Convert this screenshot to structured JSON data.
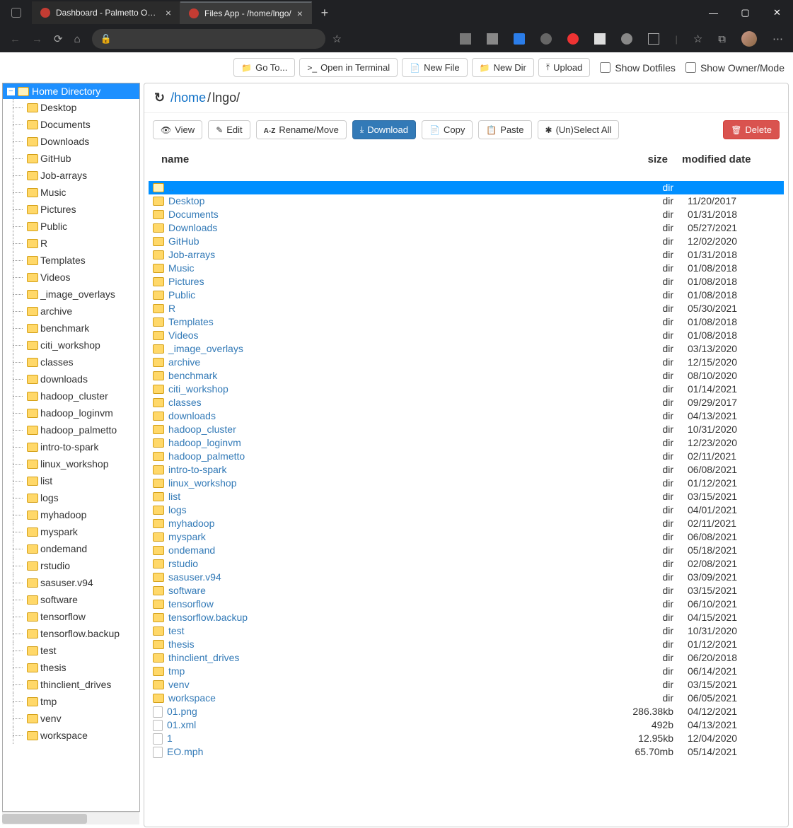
{
  "browser": {
    "tabs": [
      {
        "title": "Dashboard - Palmetto OnDeman",
        "active": false
      },
      {
        "title": "Files App - /home/lngo/",
        "active": true
      }
    ]
  },
  "app_toolbar": {
    "goto": "Go To...",
    "terminal": "Open in Terminal",
    "newfile": "New File",
    "newdir": "New Dir",
    "upload": "Upload",
    "dotfiles": "Show Dotfiles",
    "owner": "Show Owner/Mode"
  },
  "sidebar": {
    "root": "Home Directory",
    "items": [
      "Desktop",
      "Documents",
      "Downloads",
      "GitHub",
      "Job-arrays",
      "Music",
      "Pictures",
      "Public",
      "R",
      "Templates",
      "Videos",
      "_image_overlays",
      "archive",
      "benchmark",
      "citi_workshop",
      "classes",
      "downloads",
      "hadoop_cluster",
      "hadoop_loginvm",
      "hadoop_palmetto",
      "intro-to-spark",
      "linux_workshop",
      "list",
      "logs",
      "myhadoop",
      "myspark",
      "ondemand",
      "rstudio",
      "sasuser.v94",
      "software",
      "tensorflow",
      "tensorflow.backup",
      "test",
      "thesis",
      "thinclient_drives",
      "tmp",
      "venv",
      "workspace"
    ]
  },
  "breadcrumb": {
    "home": "/home",
    "sep": "/",
    "cur": "lngo/"
  },
  "file_toolbar": {
    "view": "View",
    "edit": "Edit",
    "rename": "Rename/Move",
    "download": "Download",
    "copy": "Copy",
    "paste": "Paste",
    "select": "(Un)Select All",
    "delete": "Delete"
  },
  "columns": {
    "name": "name",
    "size": "size",
    "date": "modified date"
  },
  "files": [
    {
      "n": "..",
      "s": "dir",
      "d": "",
      "dir": true,
      "sel": true
    },
    {
      "n": "Desktop",
      "s": "dir",
      "d": "11/20/2017",
      "dir": true
    },
    {
      "n": "Documents",
      "s": "dir",
      "d": "01/31/2018",
      "dir": true
    },
    {
      "n": "Downloads",
      "s": "dir",
      "d": "05/27/2021",
      "dir": true
    },
    {
      "n": "GitHub",
      "s": "dir",
      "d": "12/02/2020",
      "dir": true
    },
    {
      "n": "Job-arrays",
      "s": "dir",
      "d": "01/31/2018",
      "dir": true
    },
    {
      "n": "Music",
      "s": "dir",
      "d": "01/08/2018",
      "dir": true
    },
    {
      "n": "Pictures",
      "s": "dir",
      "d": "01/08/2018",
      "dir": true
    },
    {
      "n": "Public",
      "s": "dir",
      "d": "01/08/2018",
      "dir": true
    },
    {
      "n": "R",
      "s": "dir",
      "d": "05/30/2021",
      "dir": true
    },
    {
      "n": "Templates",
      "s": "dir",
      "d": "01/08/2018",
      "dir": true
    },
    {
      "n": "Videos",
      "s": "dir",
      "d": "01/08/2018",
      "dir": true
    },
    {
      "n": "_image_overlays",
      "s": "dir",
      "d": "03/13/2020",
      "dir": true
    },
    {
      "n": "archive",
      "s": "dir",
      "d": "12/15/2020",
      "dir": true
    },
    {
      "n": "benchmark",
      "s": "dir",
      "d": "08/10/2020",
      "dir": true
    },
    {
      "n": "citi_workshop",
      "s": "dir",
      "d": "01/14/2021",
      "dir": true
    },
    {
      "n": "classes",
      "s": "dir",
      "d": "09/29/2017",
      "dir": true
    },
    {
      "n": "downloads",
      "s": "dir",
      "d": "04/13/2021",
      "dir": true
    },
    {
      "n": "hadoop_cluster",
      "s": "dir",
      "d": "10/31/2020",
      "dir": true
    },
    {
      "n": "hadoop_loginvm",
      "s": "dir",
      "d": "12/23/2020",
      "dir": true
    },
    {
      "n": "hadoop_palmetto",
      "s": "dir",
      "d": "02/11/2021",
      "dir": true
    },
    {
      "n": "intro-to-spark",
      "s": "dir",
      "d": "06/08/2021",
      "dir": true
    },
    {
      "n": "linux_workshop",
      "s": "dir",
      "d": "01/12/2021",
      "dir": true
    },
    {
      "n": "list",
      "s": "dir",
      "d": "03/15/2021",
      "dir": true
    },
    {
      "n": "logs",
      "s": "dir",
      "d": "04/01/2021",
      "dir": true
    },
    {
      "n": "myhadoop",
      "s": "dir",
      "d": "02/11/2021",
      "dir": true
    },
    {
      "n": "myspark",
      "s": "dir",
      "d": "06/08/2021",
      "dir": true
    },
    {
      "n": "ondemand",
      "s": "dir",
      "d": "05/18/2021",
      "dir": true
    },
    {
      "n": "rstudio",
      "s": "dir",
      "d": "02/08/2021",
      "dir": true
    },
    {
      "n": "sasuser.v94",
      "s": "dir",
      "d": "03/09/2021",
      "dir": true
    },
    {
      "n": "software",
      "s": "dir",
      "d": "03/15/2021",
      "dir": true
    },
    {
      "n": "tensorflow",
      "s": "dir",
      "d": "06/10/2021",
      "dir": true
    },
    {
      "n": "tensorflow.backup",
      "s": "dir",
      "d": "04/15/2021",
      "dir": true
    },
    {
      "n": "test",
      "s": "dir",
      "d": "10/31/2020",
      "dir": true
    },
    {
      "n": "thesis",
      "s": "dir",
      "d": "01/12/2021",
      "dir": true
    },
    {
      "n": "thinclient_drives",
      "s": "dir",
      "d": "06/20/2018",
      "dir": true
    },
    {
      "n": "tmp",
      "s": "dir",
      "d": "06/14/2021",
      "dir": true
    },
    {
      "n": "venv",
      "s": "dir",
      "d": "03/15/2021",
      "dir": true
    },
    {
      "n": "workspace",
      "s": "dir",
      "d": "06/05/2021",
      "dir": true
    },
    {
      "n": "01.png",
      "s": "286.38kb",
      "d": "04/12/2021",
      "dir": false
    },
    {
      "n": "01.xml",
      "s": "492b",
      "d": "04/13/2021",
      "dir": false
    },
    {
      "n": "1",
      "s": "12.95kb",
      "d": "12/04/2020",
      "dir": false
    },
    {
      "n": "EO.mph",
      "s": "65.70mb",
      "d": "05/14/2021",
      "dir": false
    }
  ]
}
